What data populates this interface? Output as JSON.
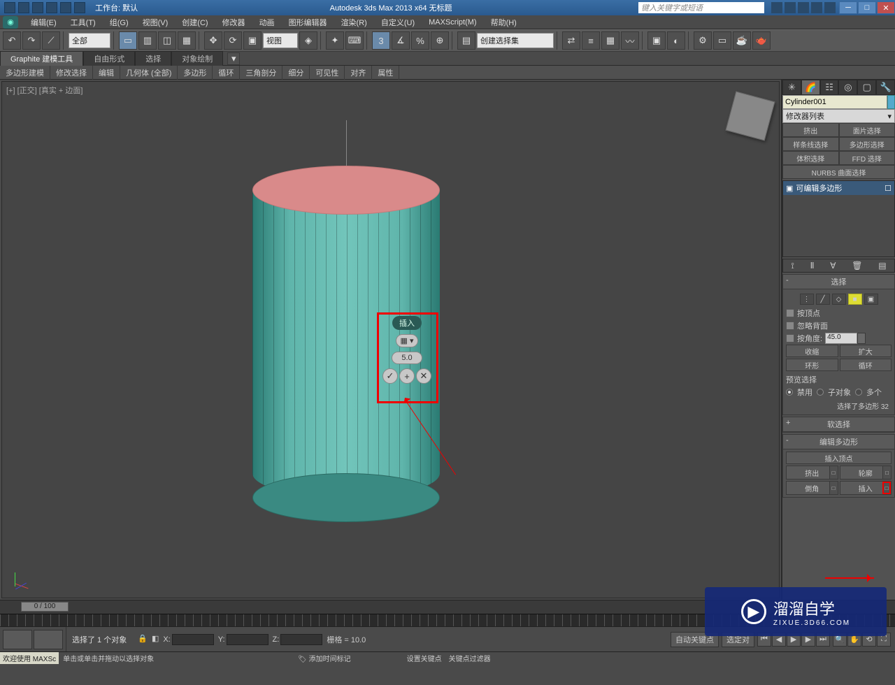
{
  "title_bar": {
    "workspace_label": "工作台: 默认",
    "app_title": "Autodesk 3ds Max  2013 x64     无标题",
    "search_placeholder": "键入关键字或短语"
  },
  "menu": {
    "items": [
      "编辑(E)",
      "工具(T)",
      "组(G)",
      "视图(V)",
      "创建(C)",
      "修改器",
      "动画",
      "图形编辑器",
      "渲染(R)",
      "自定义(U)",
      "MAXScript(M)",
      "帮助(H)"
    ]
  },
  "toolbar": {
    "filter_dropdown": "全部",
    "view_dropdown": "视图",
    "named_sel_dropdown": "创建选择集"
  },
  "ribbon": {
    "tabs": [
      "Graphite 建模工具",
      "自由形式",
      "选择",
      "对象绘制"
    ],
    "subtabs": [
      "多边形建模",
      "修改选择",
      "编辑",
      "几何体 (全部)",
      "多边形",
      "循环",
      "三角剖分",
      "细分",
      "可见性",
      "对齐",
      "属性"
    ]
  },
  "viewport": {
    "label": "[+] [正交] [真实 + 边面]",
    "caddy": {
      "title": "插入",
      "amount": "5.0",
      "ok_glyph": "✓",
      "plus_glyph": "+",
      "cancel_glyph": "✕"
    }
  },
  "panel": {
    "object_name": "Cylinder001",
    "modifier_list_label": "修改器列表",
    "mod_buttons": [
      "挤出",
      "面片选择",
      "样条线选择",
      "多边形选择",
      "体积选择",
      "FFD 选择"
    ],
    "nurbs_label": "NURBS 曲面选择",
    "stack_item": "可编辑多边形",
    "rollout_select": {
      "header": "选择",
      "by_vertex": "按顶点",
      "ignore_back": "忽略背面",
      "by_angle": "按角度:",
      "angle_val": "45.0",
      "shrink": "收缩",
      "grow": "扩大",
      "ring": "环形",
      "loop": "循环",
      "preview_label": "预览选择",
      "radio_disable": "禁用",
      "radio_subobj": "子对象",
      "radio_multi": "多个",
      "selected_text": "选择了多边形 32"
    },
    "rollout_soft": "软选择",
    "rollout_edit": {
      "header": "编辑多边形",
      "insert_vertex": "插入顶点",
      "extrude": "挤出",
      "outline": "轮廓",
      "bevel": "倒角",
      "inset": "插入"
    }
  },
  "time": {
    "slider_value": "0 / 100"
  },
  "status": {
    "sel_msg": "选择了 1 个对象",
    "hint_msg": "单击或单击并拖动以选择对象",
    "x_label": "X:",
    "y_label": "Y:",
    "z_label": "Z:",
    "grid": "栅格 = 10.0",
    "auto_key": "自动关键点",
    "set_key": "设置关键点",
    "sel_lock": "选定对",
    "key_filter": "关键点过滤器",
    "add_time_tag": "添加时间标记",
    "welcome": "欢迎使用  MAXSc"
  },
  "watermark": {
    "brand": "溜溜自学",
    "url": "ZIXUE.3D66.COM"
  }
}
